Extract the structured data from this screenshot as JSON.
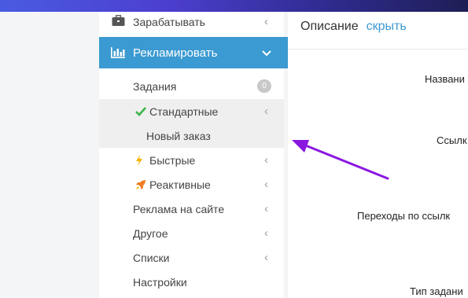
{
  "sidebar": {
    "earn_label": "Зарабатывать",
    "advertise_label": "Рекламировать",
    "tasks_label": "Задания",
    "tasks_count": "0",
    "standard_label": "Стандартные",
    "new_order_label": "Новый заказ",
    "fast_label": "Быстрые",
    "reactive_label": "Реактивные",
    "site_ads_label": "Реклама на сайте",
    "other_label": "Другое",
    "lists_label": "Списки",
    "settings_label": "Настройки"
  },
  "main": {
    "description_title": "Описание",
    "hide_link": "скрыть",
    "field_name_label": "Названи",
    "field_link_label": "Ссылк",
    "field_clicks_label": "Переходы по ссылк",
    "field_task_type_label": "Тип задани"
  },
  "colors": {
    "accent": "#3b9ad1",
    "annotation_arrow": "#8a18e0",
    "check_green": "#3bb54a",
    "fast_icon": "#f5b400",
    "reactive_icon": "#f07e26"
  }
}
